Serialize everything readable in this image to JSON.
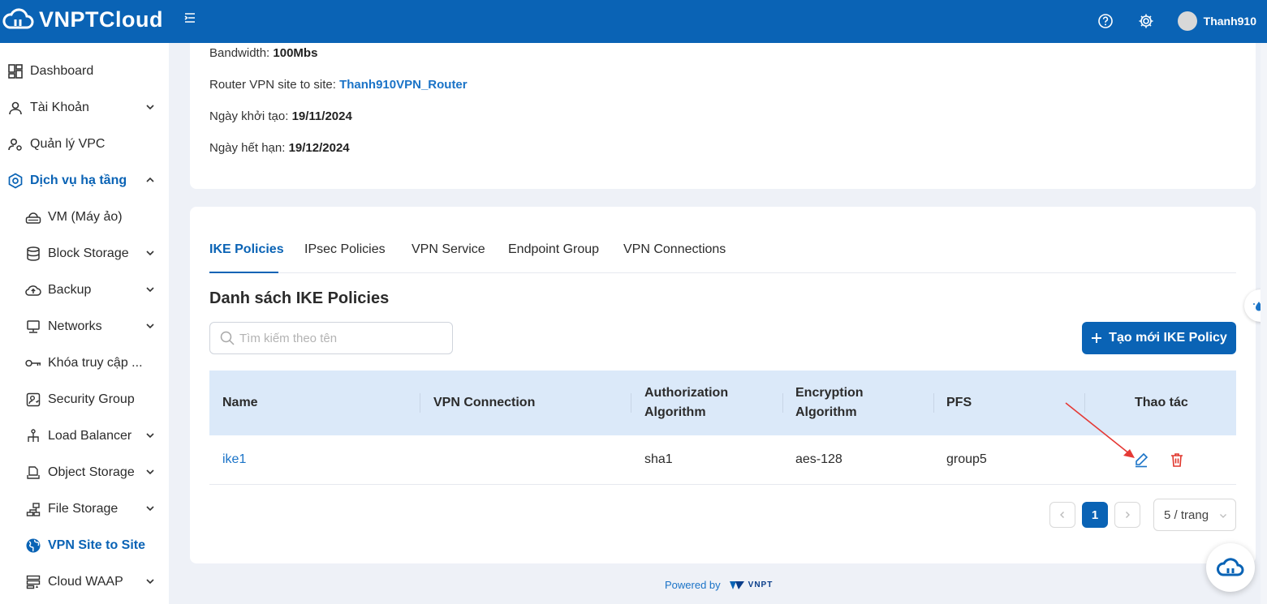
{
  "brand": {
    "name": "VNPTCloud"
  },
  "header": {
    "username": "Thanh910",
    "icons": [
      "help-icon",
      "settings-icon"
    ]
  },
  "sidebar": {
    "items": [
      {
        "label": "Dashboard",
        "icon": "dashboard-icon"
      },
      {
        "label": "Tài Khoản",
        "icon": "user-icon"
      },
      {
        "label": "Quản lý VPC",
        "icon": "user-settings-icon"
      },
      {
        "label": "Dịch vụ hạ tầng",
        "icon": "hexagon-icon"
      },
      {
        "label": "VM (Máy ảo)",
        "icon": "vm-icon"
      },
      {
        "label": "Block Storage",
        "icon": "database-icon"
      },
      {
        "label": "Backup",
        "icon": "cloud-upload-icon"
      },
      {
        "label": "Networks",
        "icon": "monitor-icon"
      },
      {
        "label": "Khóa truy cập ...",
        "icon": "key-icon"
      },
      {
        "label": "Security Group",
        "icon": "security-group-icon"
      },
      {
        "label": "Load Balancer",
        "icon": "load-balancer-icon"
      },
      {
        "label": "Object Storage",
        "icon": "object-storage-icon"
      },
      {
        "label": "File Storage",
        "icon": "file-storage-icon"
      },
      {
        "label": "VPN Site to Site",
        "icon": "globe-icon"
      },
      {
        "label": "Cloud WAAP",
        "icon": "waap-icon"
      }
    ]
  },
  "info": {
    "bandwidth_label": "Bandwidth: ",
    "bandwidth_value": "100Mbs",
    "router_label": "Router VPN site to site: ",
    "router_value": "Thanh910VPN_Router",
    "created_label": "Ngày khởi tạo: ",
    "created_value": "19/11/2024",
    "expire_label": "Ngày hết hạn: ",
    "expire_value": "19/12/2024"
  },
  "tabs": [
    "IKE Policies",
    "IPsec Policies",
    "VPN Service",
    "Endpoint Group",
    "VPN Connections"
  ],
  "section": {
    "title": "Danh sách IKE Policies",
    "search_placeholder": "Tìm kiếm theo tên",
    "create_label": "Tạo mới IKE Policy"
  },
  "table": {
    "columns": [
      "Name",
      "VPN Connection",
      "Authorization Algorithm",
      "Encryption Algorithm",
      "PFS",
      "Thao tác"
    ],
    "rows": [
      {
        "name": "ike1",
        "vpn_connection": "",
        "auth": "sha1",
        "enc": "aes-128",
        "pfs": "group5"
      }
    ]
  },
  "pagination": {
    "current": "1",
    "page_size": "5 / trang"
  },
  "footer": {
    "powered_by": "Powered by",
    "vnpt": "VNPT"
  },
  "colors": {
    "primary": "#0a63b5",
    "header_bg": "#0a63b5",
    "table_head": "#dbe9f9",
    "danger": "#e0352b",
    "annotation": "#e53935"
  }
}
